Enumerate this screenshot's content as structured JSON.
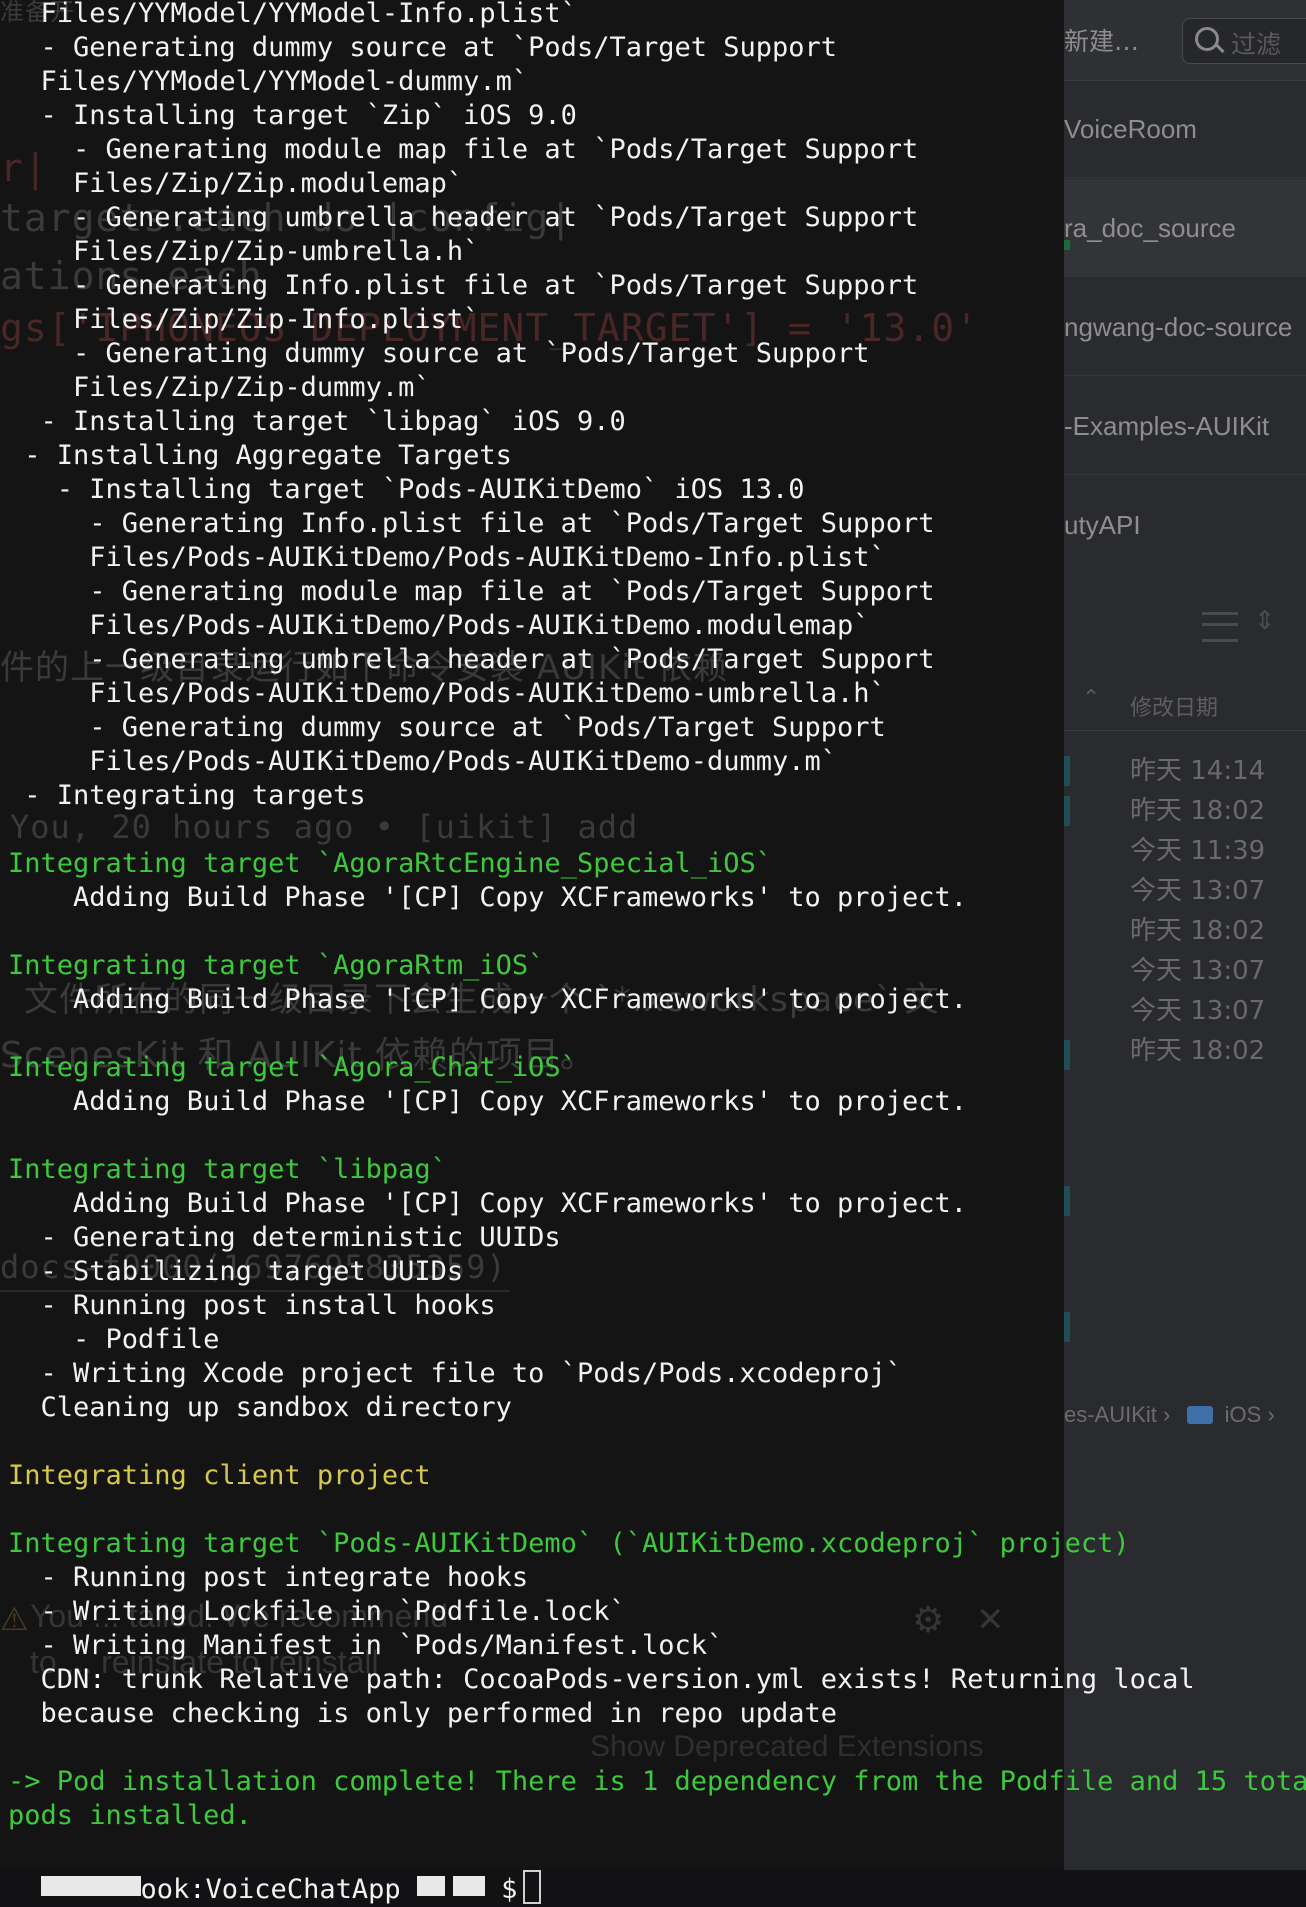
{
  "terminal": {
    "lines": [
      {
        "text": "  Files/YYModel/YYModel-Info.plist`",
        "color": "white"
      },
      {
        "text": "  - Generating dummy source at `Pods/Target Support",
        "color": "white"
      },
      {
        "text": "  Files/YYModel/YYModel-dummy.m`",
        "color": "white"
      },
      {
        "text": "  - Installing target `Zip` iOS 9.0",
        "color": "white"
      },
      {
        "text": "    - Generating module map file at `Pods/Target Support",
        "color": "white"
      },
      {
        "text": "    Files/Zip/Zip.modulemap`",
        "color": "white"
      },
      {
        "text": "    - Generating umbrella header at `Pods/Target Support",
        "color": "white"
      },
      {
        "text": "    Files/Zip/Zip-umbrella.h`",
        "color": "white"
      },
      {
        "text": "    - Generating Info.plist file at `Pods/Target Support",
        "color": "white"
      },
      {
        "text": "    Files/Zip/Zip-Info.plist`",
        "color": "white"
      },
      {
        "text": "    - Generating dummy source at `Pods/Target Support",
        "color": "white"
      },
      {
        "text": "    Files/Zip/Zip-dummy.m`",
        "color": "white"
      },
      {
        "text": "  - Installing target `libpag` iOS 9.0",
        "color": "white"
      },
      {
        "text": " - Installing Aggregate Targets",
        "color": "white"
      },
      {
        "text": "   - Installing target `Pods-AUIKitDemo` iOS 13.0",
        "color": "white"
      },
      {
        "text": "     - Generating Info.plist file at `Pods/Target Support",
        "color": "white"
      },
      {
        "text": "     Files/Pods-AUIKitDemo/Pods-AUIKitDemo-Info.plist`",
        "color": "white"
      },
      {
        "text": "     - Generating module map file at `Pods/Target Support",
        "color": "white"
      },
      {
        "text": "     Files/Pods-AUIKitDemo/Pods-AUIKitDemo.modulemap`",
        "color": "white"
      },
      {
        "text": "     - Generating umbrella header at `Pods/Target Support",
        "color": "white"
      },
      {
        "text": "     Files/Pods-AUIKitDemo/Pods-AUIKitDemo-umbrella.h`",
        "color": "white"
      },
      {
        "text": "     - Generating dummy source at `Pods/Target Support",
        "color": "white"
      },
      {
        "text": "     Files/Pods-AUIKitDemo/Pods-AUIKitDemo-dummy.m`",
        "color": "white"
      },
      {
        "text": " - Integrating targets",
        "color": "white"
      },
      {
        "text": "",
        "color": "white"
      },
      {
        "text": "Integrating target `AgoraRtcEngine_Special_iOS`",
        "color": "green"
      },
      {
        "text": "    Adding Build Phase '[CP] Copy XCFrameworks' to project.",
        "color": "white"
      },
      {
        "text": "",
        "color": "white"
      },
      {
        "text": "Integrating target `AgoraRtm_iOS`",
        "color": "green"
      },
      {
        "text": "    Adding Build Phase '[CP] Copy XCFrameworks' to project.",
        "color": "white"
      },
      {
        "text": "",
        "color": "white"
      },
      {
        "text": "Integrating target `Agora_Chat_iOS`",
        "color": "green"
      },
      {
        "text": "    Adding Build Phase '[CP] Copy XCFrameworks' to project.",
        "color": "white"
      },
      {
        "text": "",
        "color": "white"
      },
      {
        "text": "Integrating target `libpag`",
        "color": "green"
      },
      {
        "text": "    Adding Build Phase '[CP] Copy XCFrameworks' to project.",
        "color": "white"
      },
      {
        "text": "  - Generating deterministic UUIDs",
        "color": "white"
      },
      {
        "text": "  - Stabilizing target UUIDs",
        "color": "white"
      },
      {
        "text": "  - Running post install hooks",
        "color": "white"
      },
      {
        "text": "    - Podfile",
        "color": "white"
      },
      {
        "text": "  - Writing Xcode project file to `Pods/Pods.xcodeproj`",
        "color": "white"
      },
      {
        "text": "  Cleaning up sandbox directory",
        "color": "white"
      },
      {
        "text": "",
        "color": "white"
      },
      {
        "text": "Integrating client project",
        "color": "yellow"
      },
      {
        "text": "",
        "color": "white"
      },
      {
        "text": "Integrating target `Pods-AUIKitDemo` (`AUIKitDemo.xcodeproj` project)",
        "color": "green"
      },
      {
        "text": "  - Running post integrate hooks",
        "color": "white"
      },
      {
        "text": "  - Writing Lockfile in `Podfile.lock`",
        "color": "white"
      },
      {
        "text": "  - Writing Manifest in `Pods/Manifest.lock`",
        "color": "white"
      },
      {
        "text": "  CDN: trunk Relative path: CocoaPods-version.yml exists! Returning local",
        "color": "white"
      },
      {
        "text": "  because checking is only performed in repo update",
        "color": "white"
      },
      {
        "text": "",
        "color": "white"
      },
      {
        "text": "-> Pod installation complete! There is 1 dependency from the Podfile and 15 total",
        "color": "green"
      },
      {
        "text": "pods installed.",
        "color": "green"
      }
    ],
    "prompt": {
      "host_part": "ook:VoiceChatApp",
      "suffix": "$"
    }
  },
  "background_editor": {
    "ghost_texts": [
      {
        "text": "准备开",
        "kind": "zh"
      },
      {
        "text": "r|",
        "kind": "red"
      },
      {
        "text": "targets.each do |config|",
        "kind": "mono"
      },
      {
        "text": "ations.each",
        "kind": "mono"
      },
      {
        "text": "gs['IPHONEOS_DEPLOYMENT_TARGET'] = '13.0'",
        "kind": "red"
      },
      {
        "text": "件的上一级目录运行如下命令安装 AUIKit 依赖",
        "kind": "zh"
      },
      {
        "text": "You, 20 hours ago • [uikit] add",
        "kind": "mono"
      },
      {
        "text": "文件所在的同一级目录下会生成一个 `*.xcworkspace` 文",
        "kind": "zh"
      },
      {
        "text": "ScenesKit 和 AUIKit 依赖的项目。",
        "kind": "zh"
      },
      {
        "text": "docs-f0000(1697695835359)",
        "kind": "mono"
      }
    ]
  },
  "background_finder": {
    "toolbar": {
      "new_label": "新建…",
      "search_placeholder": "过滤"
    },
    "rows": [
      "VoiceRoom",
      "ra_doc_source",
      "ngwang-doc-source",
      "-Examples-AUIKit",
      "utyAPI"
    ],
    "column_header": "修改日期",
    "dates": [
      "昨天 14:14",
      "昨天 18:02",
      "今天 11:39",
      "今天 13:07",
      "昨天 18:02",
      "今天 13:07",
      "今天 13:07",
      "昨天 18:02"
    ],
    "path_bar": {
      "segment1": "es-AUIKit",
      "segment2": "iOS"
    }
  },
  "notification": {
    "line1": "You      ...                               talled. We recommend",
    "line2": "to ...                     reinstate to reinstall",
    "deprecated": "Show Deprecated Extensions"
  }
}
